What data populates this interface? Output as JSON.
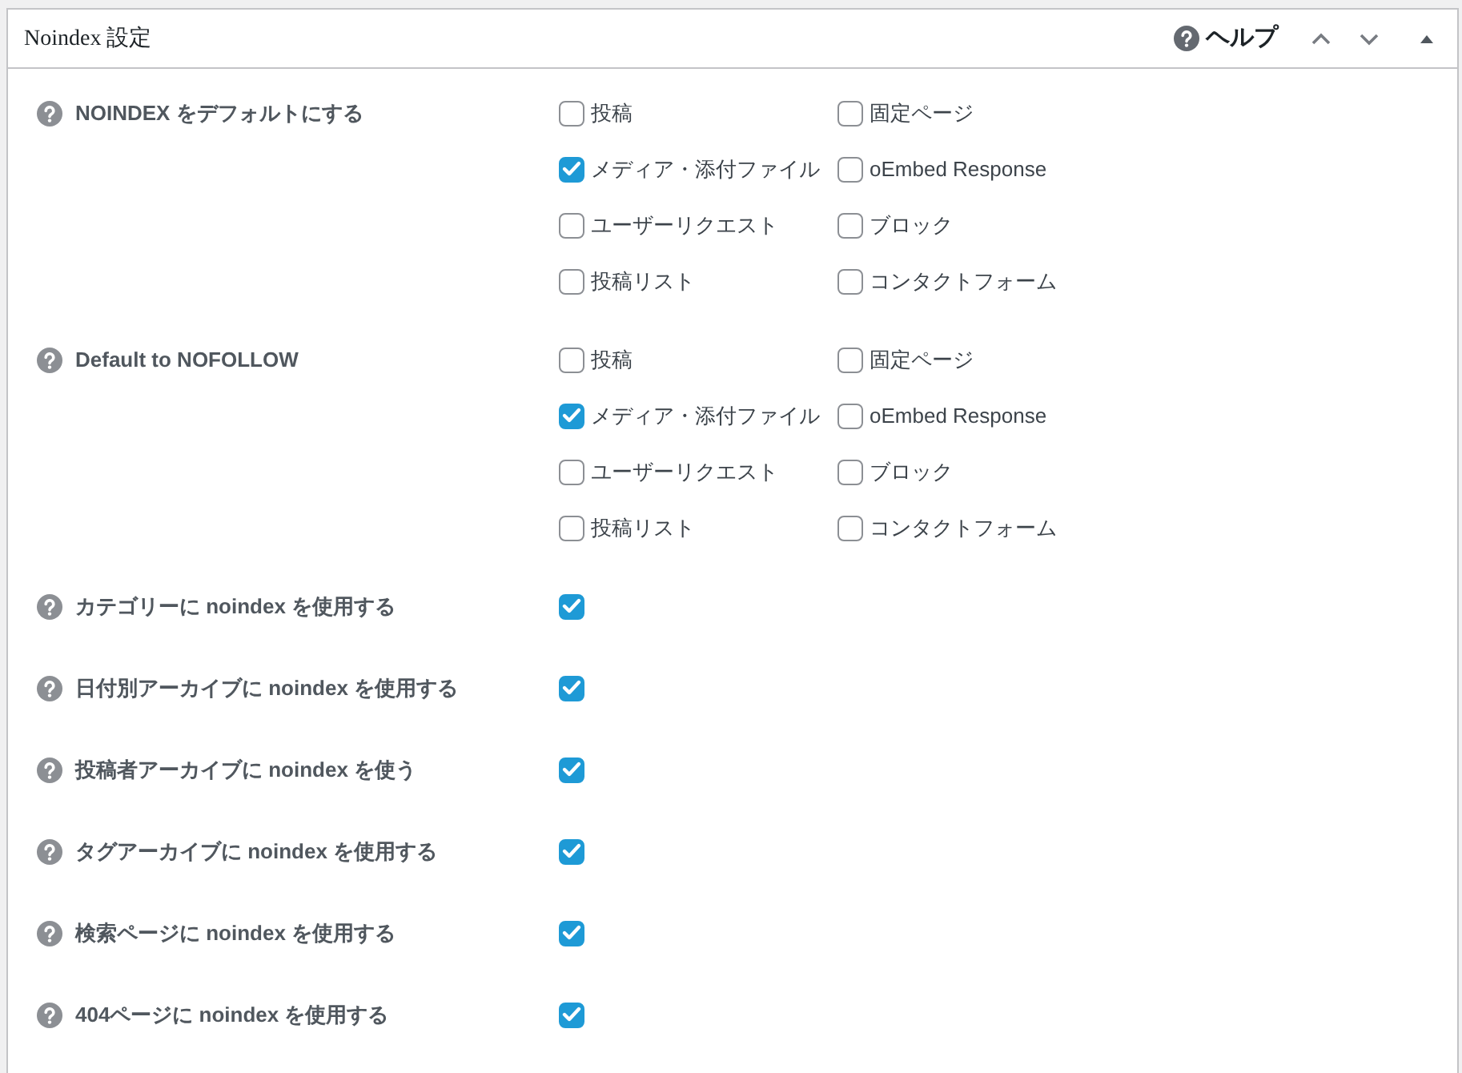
{
  "panel": {
    "title": "Noindex 設定",
    "help_label": "ヘルプ"
  },
  "settings": [
    {
      "kind": "multi",
      "label": "NOINDEX をデフォルトにする",
      "options": [
        {
          "label": "投稿",
          "checked": false
        },
        {
          "label": "固定ページ",
          "checked": false
        },
        {
          "label": "メディア・添付ファイル",
          "checked": true
        },
        {
          "label": "oEmbed Response",
          "checked": false
        },
        {
          "label": "ユーザーリクエスト",
          "checked": false
        },
        {
          "label": "ブロック",
          "checked": false
        },
        {
          "label": "投稿リスト",
          "checked": false
        },
        {
          "label": "コンタクトフォーム",
          "checked": false
        }
      ]
    },
    {
      "kind": "multi",
      "label": "Default to NOFOLLOW",
      "options": [
        {
          "label": "投稿",
          "checked": false
        },
        {
          "label": "固定ページ",
          "checked": false
        },
        {
          "label": "メディア・添付ファイル",
          "checked": true
        },
        {
          "label": "oEmbed Response",
          "checked": false
        },
        {
          "label": "ユーザーリクエスト",
          "checked": false
        },
        {
          "label": "ブロック",
          "checked": false
        },
        {
          "label": "投稿リスト",
          "checked": false
        },
        {
          "label": "コンタクトフォーム",
          "checked": false
        }
      ]
    },
    {
      "kind": "single",
      "label": "カテゴリーに noindex を使用する",
      "checked": true
    },
    {
      "kind": "single",
      "label": "日付別アーカイブに noindex を使用する",
      "checked": true
    },
    {
      "kind": "single",
      "label": "投稿者アーカイブに noindex を使う",
      "checked": true
    },
    {
      "kind": "single",
      "label": "タグアーカイブに noindex を使用する",
      "checked": true
    },
    {
      "kind": "single",
      "label": "検索ページに noindex を使用する",
      "checked": true
    },
    {
      "kind": "single",
      "label": "404ページに noindex を使用する",
      "checked": true
    }
  ]
}
